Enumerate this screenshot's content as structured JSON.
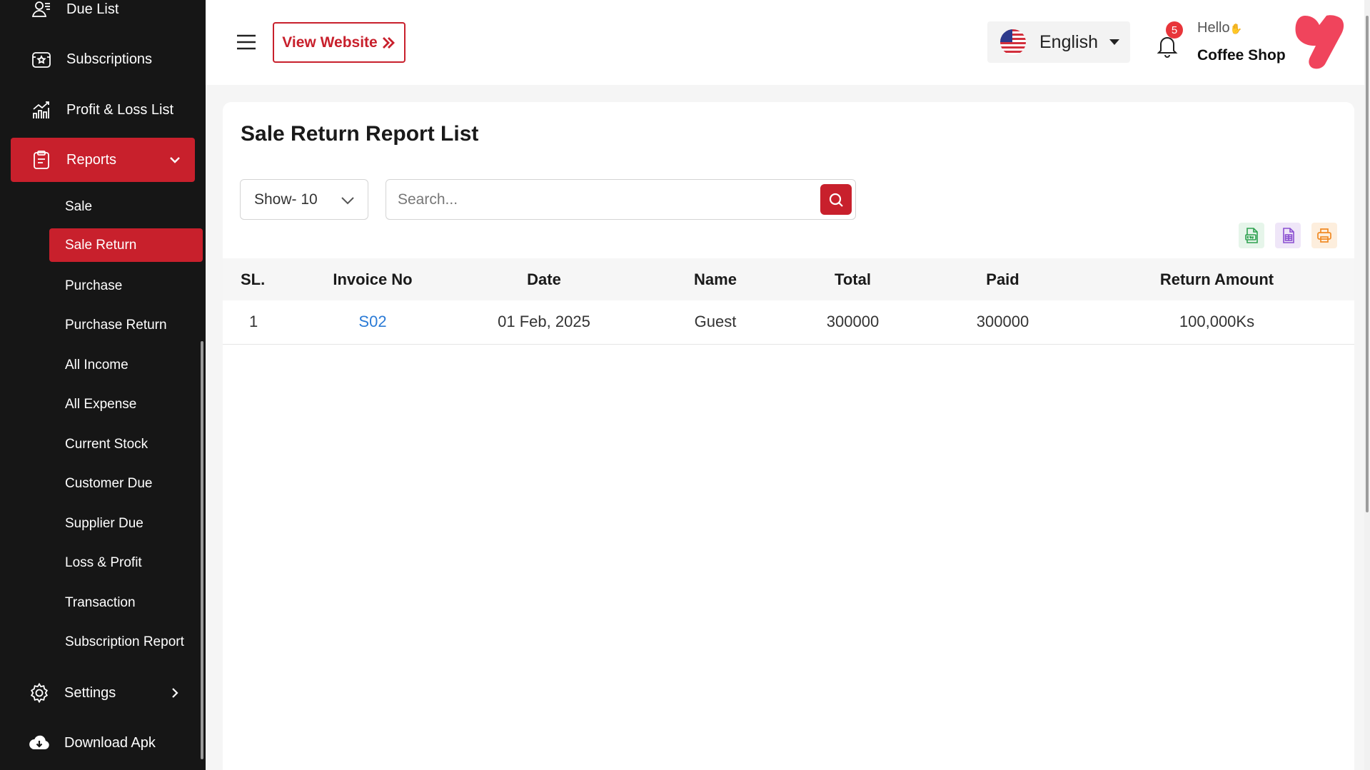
{
  "sidebar": {
    "items": [
      {
        "label": "Due List",
        "icon": "user-list-icon"
      },
      {
        "label": "Subscriptions",
        "icon": "subscription-icon"
      },
      {
        "label": "Profit & Loss List",
        "icon": "chart-icon"
      },
      {
        "label": "Reports",
        "icon": "clipboard-icon"
      },
      {
        "label": "Settings",
        "icon": "gear-icon"
      },
      {
        "label": "Download Apk",
        "icon": "cloud-download-icon"
      }
    ],
    "reports_sub": [
      "Sale",
      "Sale Return",
      "Purchase",
      "Purchase Return",
      "All Income",
      "All Expense",
      "Current Stock",
      "Customer Due",
      "Supplier Due",
      "Loss & Profit",
      "Transaction",
      "Subscription Report"
    ],
    "active_item": "Reports",
    "active_sub": "Sale Return"
  },
  "header": {
    "view_website": "View Website",
    "language": "English",
    "notification_count": "5",
    "hello": "Hello",
    "shop_name": "Coffee Shop"
  },
  "main": {
    "title": "Sale Return Report List",
    "show_select": "Show- 10",
    "search_placeholder": "Search...",
    "export_buttons": [
      "csv-icon",
      "excel-icon",
      "print-icon"
    ],
    "table": {
      "columns": [
        "SL.",
        "Invoice No",
        "Date",
        "Name",
        "Total",
        "Paid",
        "Return Amount"
      ],
      "rows": [
        {
          "sl": "1",
          "invoice": "S02",
          "date": "01 Feb, 2025",
          "name": "Guest",
          "total": "300000",
          "paid": "300000",
          "return_amount": "100,000Ks"
        }
      ]
    }
  },
  "colors": {
    "accent": "#c8202c",
    "sidebar_bg": "#161616",
    "link": "#2b7bd6"
  }
}
